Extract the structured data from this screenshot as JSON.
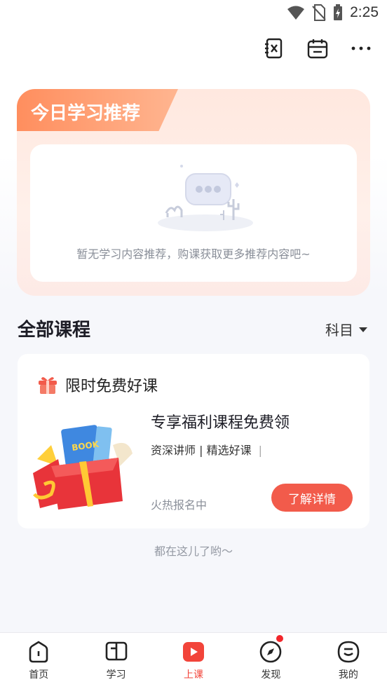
{
  "status_bar": {
    "time": "2:25"
  },
  "top_actions": [
    "notebook-x-icon",
    "calendar-icon",
    "more-icon"
  ],
  "recommend": {
    "title": "今日学习推荐",
    "empty_text": "暂无学习内容推荐，购课获取更多推荐内容吧~"
  },
  "courses": {
    "section_title": "全部课程",
    "filter_label": "科目",
    "promo_title": "限时免费好课",
    "card": {
      "name": "专享福利课程免费领",
      "tags": "资深讲师 | 精选好课",
      "tag_sep": "|",
      "status": "火热报名中",
      "button": "了解详情",
      "book_label": "BOOK"
    },
    "end_hint": "都在这儿了哟～"
  },
  "nav": {
    "items": [
      {
        "label": "首页",
        "icon": "home-icon"
      },
      {
        "label": "学习",
        "icon": "study-icon"
      },
      {
        "label": "上课",
        "icon": "class-play-icon"
      },
      {
        "label": "发现",
        "icon": "compass-icon"
      },
      {
        "label": "我的",
        "icon": "profile-icon"
      }
    ],
    "active_index": 2
  },
  "colors": {
    "accent": "#f25b4b",
    "active_nav": "#f2443a",
    "tab_gradient_start": "#ff8e5e"
  }
}
